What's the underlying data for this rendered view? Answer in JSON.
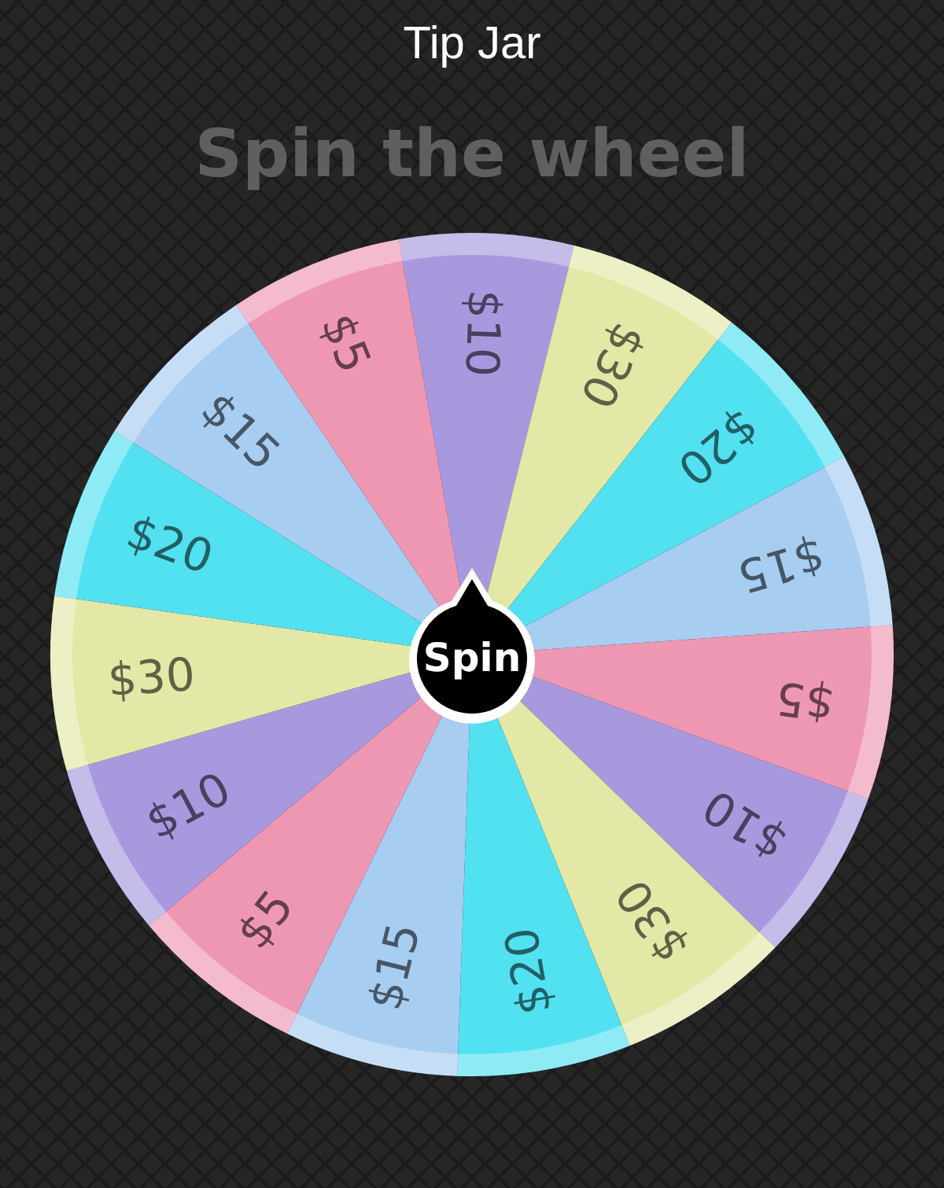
{
  "title": "Tip Jar",
  "heading": "Spin the wheel",
  "wheel": {
    "segments": [
      {
        "label": "$10",
        "color": "#a899df"
      },
      {
        "label": "$30",
        "color": "#e3e8a6"
      },
      {
        "label": "$20",
        "color": "#52e1f1"
      },
      {
        "label": "$15",
        "color": "#a7cdf1"
      },
      {
        "label": "$5",
        "color": "#ee97b3"
      },
      {
        "label": "$10",
        "color": "#a899df"
      },
      {
        "label": "$30",
        "color": "#e3e8a6"
      },
      {
        "label": "$20",
        "color": "#52e1f1"
      },
      {
        "label": "$15",
        "color": "#a7cdf1"
      },
      {
        "label": "$5",
        "color": "#ee97b3"
      },
      {
        "label": "$10",
        "color": "#a899df"
      },
      {
        "label": "$30",
        "color": "#e3e8a6"
      },
      {
        "label": "$20",
        "color": "#52e1f1"
      },
      {
        "label": "$15",
        "color": "#a7cdf1"
      },
      {
        "label": "$5",
        "color": "#ee97b3"
      }
    ],
    "spin_button": "Spin"
  }
}
